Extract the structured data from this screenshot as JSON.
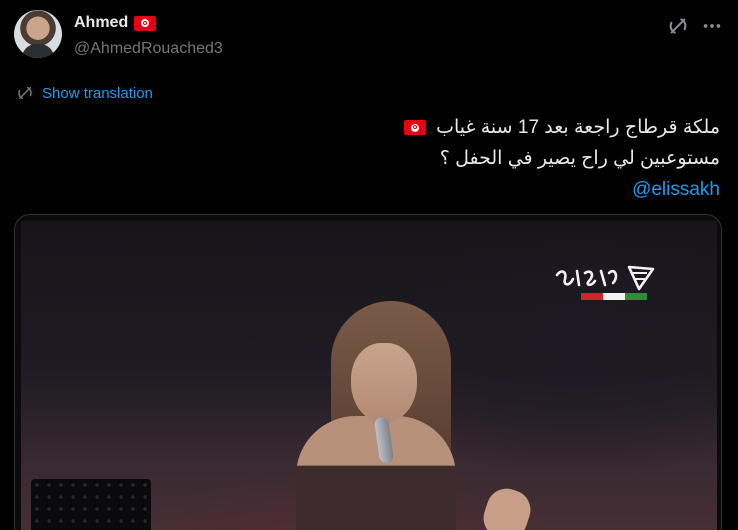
{
  "author": {
    "display_name": "Ahmed",
    "handle": "@AhmedRouached3",
    "badge_flag": "tunisia-flag"
  },
  "actions": {
    "grok_icon": "grok-icon",
    "more_icon": "more-options-icon"
  },
  "translation": {
    "label": "Show translation",
    "icon": "translate-icon"
  },
  "tweet": {
    "line1_text": "ملكة قرطاج راجعة بعد 17 سنة غياب",
    "line1_flag": "tunisia-flag",
    "line2_text": "مستوعبين لي راح يصير في الحفل ؟",
    "mention": "@elissakh"
  },
  "media": {
    "type": "video-frame",
    "channel_logo": "channel-logo"
  },
  "colors": {
    "background": "#000000",
    "text_primary": "#e7e9ea",
    "text_secondary": "#71767b",
    "link": "#1d9bf0",
    "border": "#2f3336",
    "flag_red": "#e70013"
  }
}
